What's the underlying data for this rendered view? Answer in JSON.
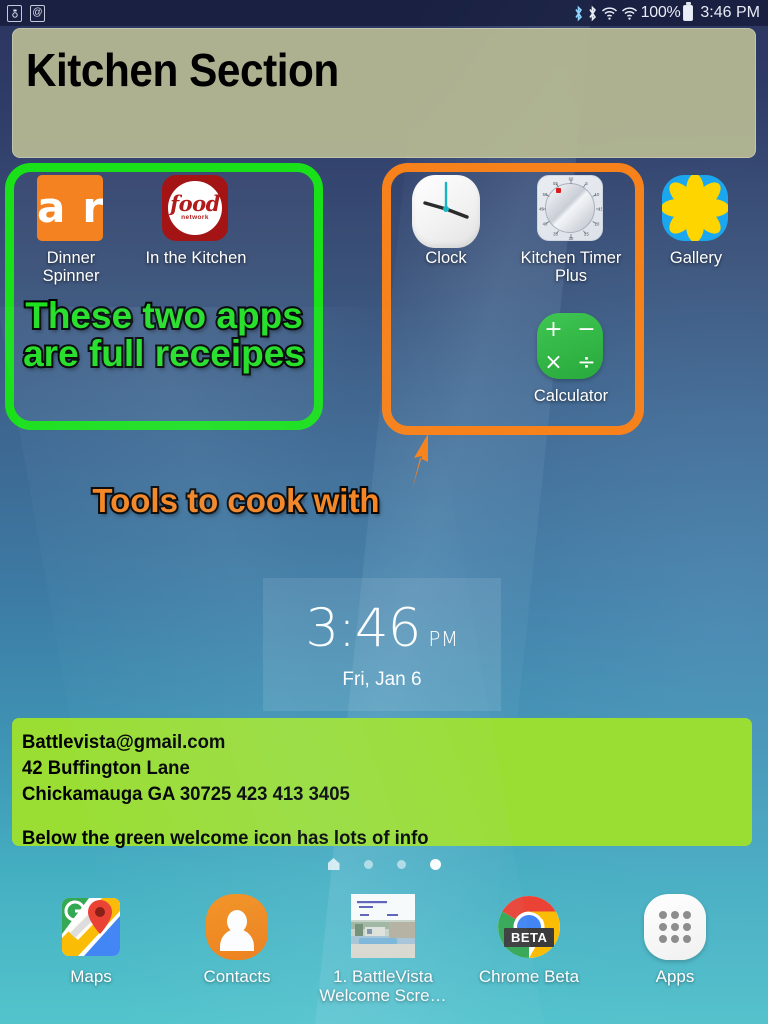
{
  "status_bar": {
    "left_icons": [
      "volume-speaker-icon",
      "email-at-icon"
    ],
    "right_icons": [
      "bluetooth-icon",
      "bluetooth-audio-icon",
      "wifi-icon",
      "wifi-signal-icon"
    ],
    "battery_percent": "100%",
    "time": "3:46 PM"
  },
  "widgets": {
    "kitchen_header": {
      "title": "Kitchen Section"
    },
    "clock": {
      "time": "3:46",
      "ampm": "PM",
      "date": "Fri, Jan 6"
    },
    "info_note": {
      "line1": "Battlevista@gmail.com",
      "line2": "42 Buffington Lane",
      "line3": "Chickamauga GA 30725    423 413 3405",
      "line4": "Below the green welcome icon has lots of info",
      "background_color": "#9ade34"
    }
  },
  "annotations": {
    "green_box": {
      "text": "These two apps\nare full receipes",
      "border_color": "#19e019",
      "text_color": "#1fe01f"
    },
    "orange_box": {
      "text": "Tools to cook with",
      "border_color": "#f7821b",
      "text_color": "#f7821b",
      "arrow": "arrow-up-icon"
    }
  },
  "home_apps": [
    {
      "label": "Dinner Spinner",
      "icon": "allrecipes-dinner-spinner-icon"
    },
    {
      "label": "In the Kitchen",
      "icon": "food-network-icon"
    },
    {
      "label": "Clock",
      "icon": "clock-icon"
    },
    {
      "label": "Kitchen Timer Plus",
      "icon": "kitchen-timer-dial-icon"
    },
    {
      "label": "Gallery",
      "icon": "gallery-flower-icon"
    },
    {
      "label": "Calculator",
      "icon": "calculator-icon"
    }
  ],
  "page_indicator": {
    "pages": 4,
    "active_index": 3,
    "home_icon": "home-icon"
  },
  "dock": [
    {
      "label": "Maps",
      "icon": "google-maps-icon"
    },
    {
      "label": "Contacts",
      "icon": "contacts-person-icon"
    },
    {
      "label": "1. BattleVista Welcome Scre…",
      "icon": "photo-thumbnail-icon"
    },
    {
      "label": "Chrome Beta",
      "icon": "chrome-beta-icon",
      "badge": "BETA"
    },
    {
      "label": "Apps",
      "icon": "apps-grid-icon"
    }
  ],
  "colors": {
    "wallpaper_top": "#2b3560",
    "wallpaper_bottom": "#53c4cc",
    "header_panel": "#b7ba93",
    "accent_green": "#19e019",
    "accent_orange": "#f7821b"
  }
}
